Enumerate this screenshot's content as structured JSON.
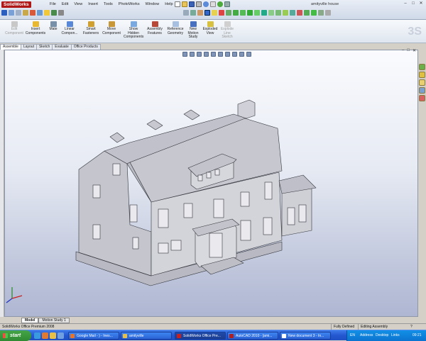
{
  "app": {
    "logo": "SolidWorks",
    "document_title": "amityville house",
    "menus": [
      "File",
      "Edit",
      "View",
      "Insert",
      "Tools",
      "PhotoWorks",
      "Window",
      "Help"
    ],
    "window_buttons": [
      "–",
      "□",
      "✕"
    ]
  },
  "command_manager": {
    "items": [
      {
        "label": "Edit Component",
        "disabled": true
      },
      {
        "label": "Insert Components",
        "disabled": false
      },
      {
        "label": "Mate",
        "disabled": false
      },
      {
        "label": "Linear Compon...",
        "disabled": false
      },
      {
        "label": "Smart Fasteners",
        "disabled": false
      },
      {
        "label": "Move Component",
        "disabled": false
      },
      {
        "label": "Show Hidden Components",
        "disabled": false
      },
      {
        "label": "Assembly Features",
        "disabled": false
      },
      {
        "label": "Reference Geometry",
        "disabled": false
      },
      {
        "label": "New Motion Study",
        "disabled": false
      },
      {
        "label": "Exploded View",
        "disabled": false
      },
      {
        "label": "Explode Line Sketch",
        "disabled": true
      }
    ]
  },
  "tabs": [
    "Assemble",
    "Layout",
    "Sketch",
    "Evaluate",
    "Office Products"
  ],
  "active_tab": "Assemble",
  "model_tabs": [
    "Model",
    "Motion Study 1"
  ],
  "active_model_tab": "Model",
  "status": {
    "product": "SolidWorks Office Premium 2008",
    "definition": "Fully Defined",
    "mode": "Editing Assembly",
    "help": "?"
  },
  "taskbar": {
    "start_label": "start",
    "tasks": [
      {
        "label": "Google Mail - ) - Ines..."
      },
      {
        "label": "amityville"
      },
      {
        "label": "SolidWorks Office Pre..."
      },
      {
        "label": "AutoCAD 2010 - [ami..."
      },
      {
        "label": "New document 3 - In..."
      }
    ],
    "tray": {
      "lang": "EN",
      "address": "Address",
      "desktop": "Desktop",
      "links": "Links",
      "clock": "09:21"
    }
  },
  "colors": {
    "accent": "#2458d0",
    "logo": "#b01818",
    "model": "#c9cad2"
  },
  "icons": [
    "select-icon",
    "save-icon",
    "rebuild-icon",
    "zoom-to-fit-icon",
    "rotate-icon",
    "axis-triad-icon"
  ]
}
